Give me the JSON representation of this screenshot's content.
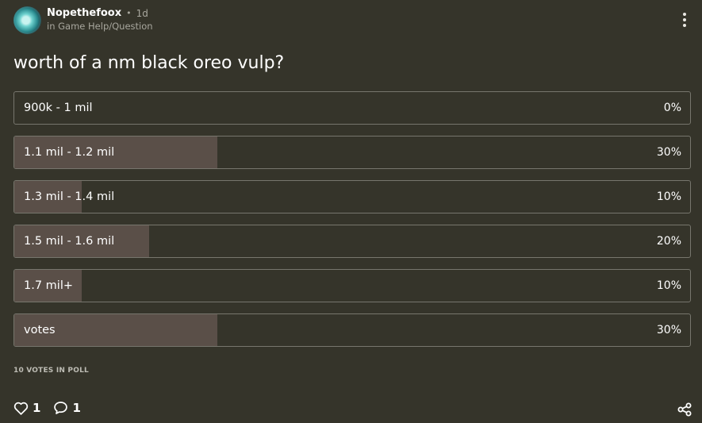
{
  "post": {
    "author": "Nopethefoox",
    "separator": "•",
    "time": "1d",
    "category": "in Game Help/Question",
    "title": "worth of a nm black oreo vulp?"
  },
  "poll": {
    "options": [
      {
        "label": "900k - 1 mil",
        "percent_text": "0%",
        "percent": 0,
        "selected": false
      },
      {
        "label": "1.1 mil - 1.2 mil",
        "percent_text": "30%",
        "percent": 30,
        "selected": false
      },
      {
        "label": "1.3 mil - 1.4 mil",
        "percent_text": "10%",
        "percent": 10,
        "selected": false
      },
      {
        "label": "1.5 mil - 1.6 mil",
        "percent_text": "20%",
        "percent": 20,
        "selected": false
      },
      {
        "label": "1.7 mil+",
        "percent_text": "10%",
        "percent": 10,
        "selected": false
      },
      {
        "label": "votes",
        "percent_text": "30%",
        "percent": 30,
        "selected": true
      }
    ],
    "total_votes_text": "10 VOTES IN POLL"
  },
  "footer": {
    "like_count": "1",
    "comment_count": "1"
  },
  "icons": {
    "menu": "more-vertical-icon",
    "like": "heart-icon",
    "comment": "comment-bubble-icon",
    "share": "share-icon"
  },
  "colors": {
    "background": "#35342a",
    "option_border": "#77766d",
    "option_fill": "#5a4f48",
    "selected_fill": "#8a7a74",
    "muted_text": "#a8a79e"
  }
}
